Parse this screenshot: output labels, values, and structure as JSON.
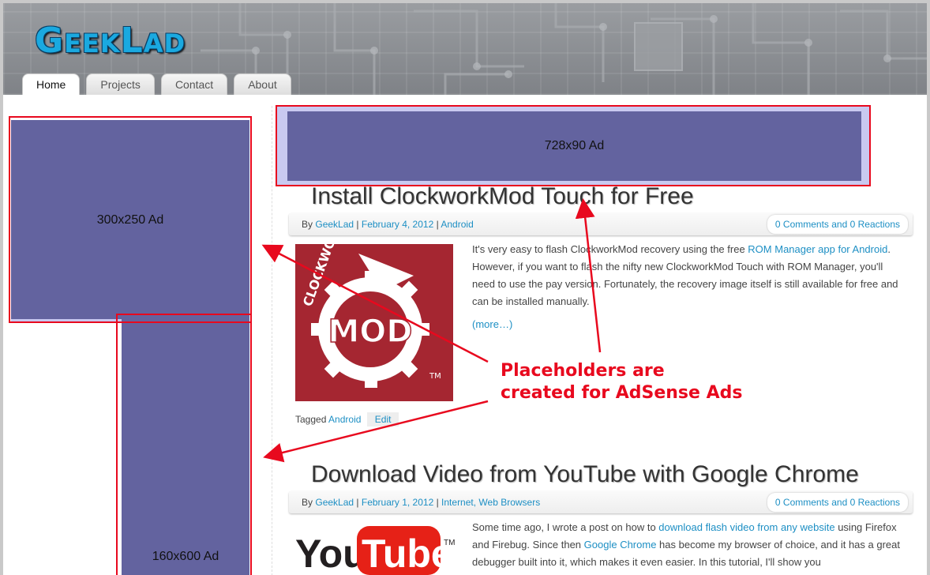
{
  "logo": {
    "first": "G",
    "rest1": "EEK",
    "second": "L",
    "rest2": "AD"
  },
  "nav": {
    "items": [
      "Home",
      "Projects",
      "Contact",
      "About"
    ]
  },
  "ads": {
    "rect": "300x250 Ad",
    "skyscraper": "160x600 Ad",
    "leaderboard": "728x90 Ad"
  },
  "posts": [
    {
      "title": "Install ClockworkMod Touch for Free",
      "by_prefix": "By",
      "author": "GeekLad",
      "date": "February 4, 2012",
      "category": "Android",
      "comments": "0 Comments and 0 Reactions",
      "thumb_alt": "CLOCKWORK MOD",
      "text_1": "It's very easy to flash ClockworkMod recovery using the free ",
      "link_1": "ROM Manager app for Android",
      "text_2": ". However, if you want to flash the nifty new ClockworkMod Touch with ROM Manager, you'll need to use the pay version. Fortunately, the recovery image itself is still available for free and can be installed manually.",
      "more": "(more…)",
      "tagged_prefix": "Tagged",
      "tag": "Android",
      "edit": "Edit"
    },
    {
      "title": "Download Video from YouTube with Google Chrome",
      "by_prefix": "By",
      "author": "GeekLad",
      "date": "February 1, 2012",
      "category": "Internet, Web Browsers",
      "comments": "0 Comments and 0 Reactions",
      "thumb_word_1": "You",
      "thumb_word_2": "Tube",
      "thumb_tm": "TM",
      "text_1": "Some time ago, I wrote a post on how to ",
      "link_1": "download flash video from any website",
      "text_2": " using Firefox and Firebug. Since then ",
      "link_2": "Google Chrome",
      "text_3": " has become my browser of choice, and it has a great debugger built into it, which makes it even easier. In this tutorial, I'll show you"
    }
  ],
  "annotation": {
    "line1": "Placeholders are",
    "line2": "created for AdSense Ads"
  },
  "colors": {
    "accent": "#1d8fc4",
    "ad": "#63639f",
    "annotation": "#e8091e"
  }
}
